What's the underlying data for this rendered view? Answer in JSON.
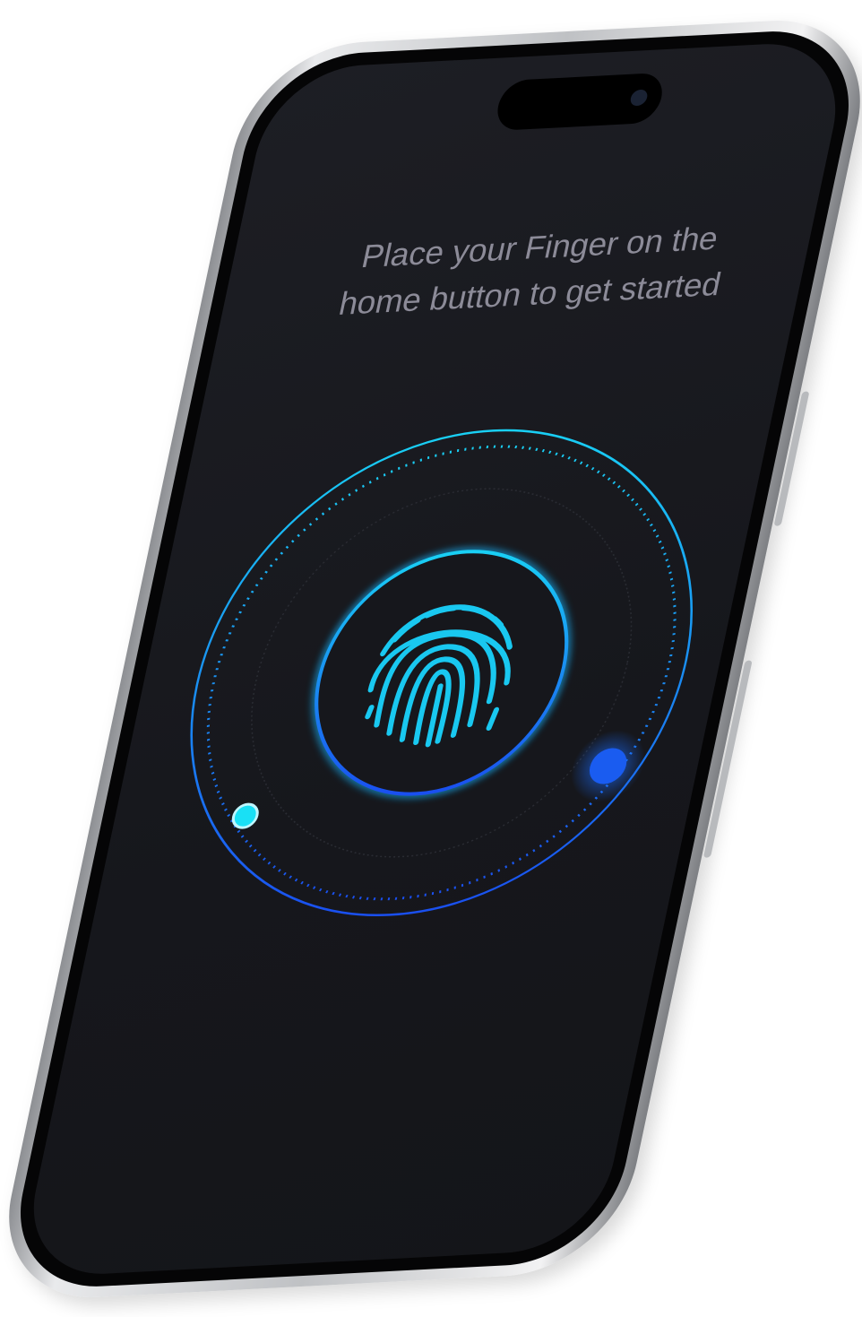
{
  "screen": {
    "prompt_line1": "Place your Finger on the",
    "prompt_line2": "home button to get started"
  },
  "icons": {
    "fingerprint": "fingerprint-icon",
    "progress_knob": "progress-knob",
    "start_dot": "start-dot"
  },
  "colors": {
    "accent_cyan": "#19d0f5",
    "accent_blue": "#1a5cf0",
    "screen_bg": "#17181d",
    "text": "#8c8b98"
  }
}
